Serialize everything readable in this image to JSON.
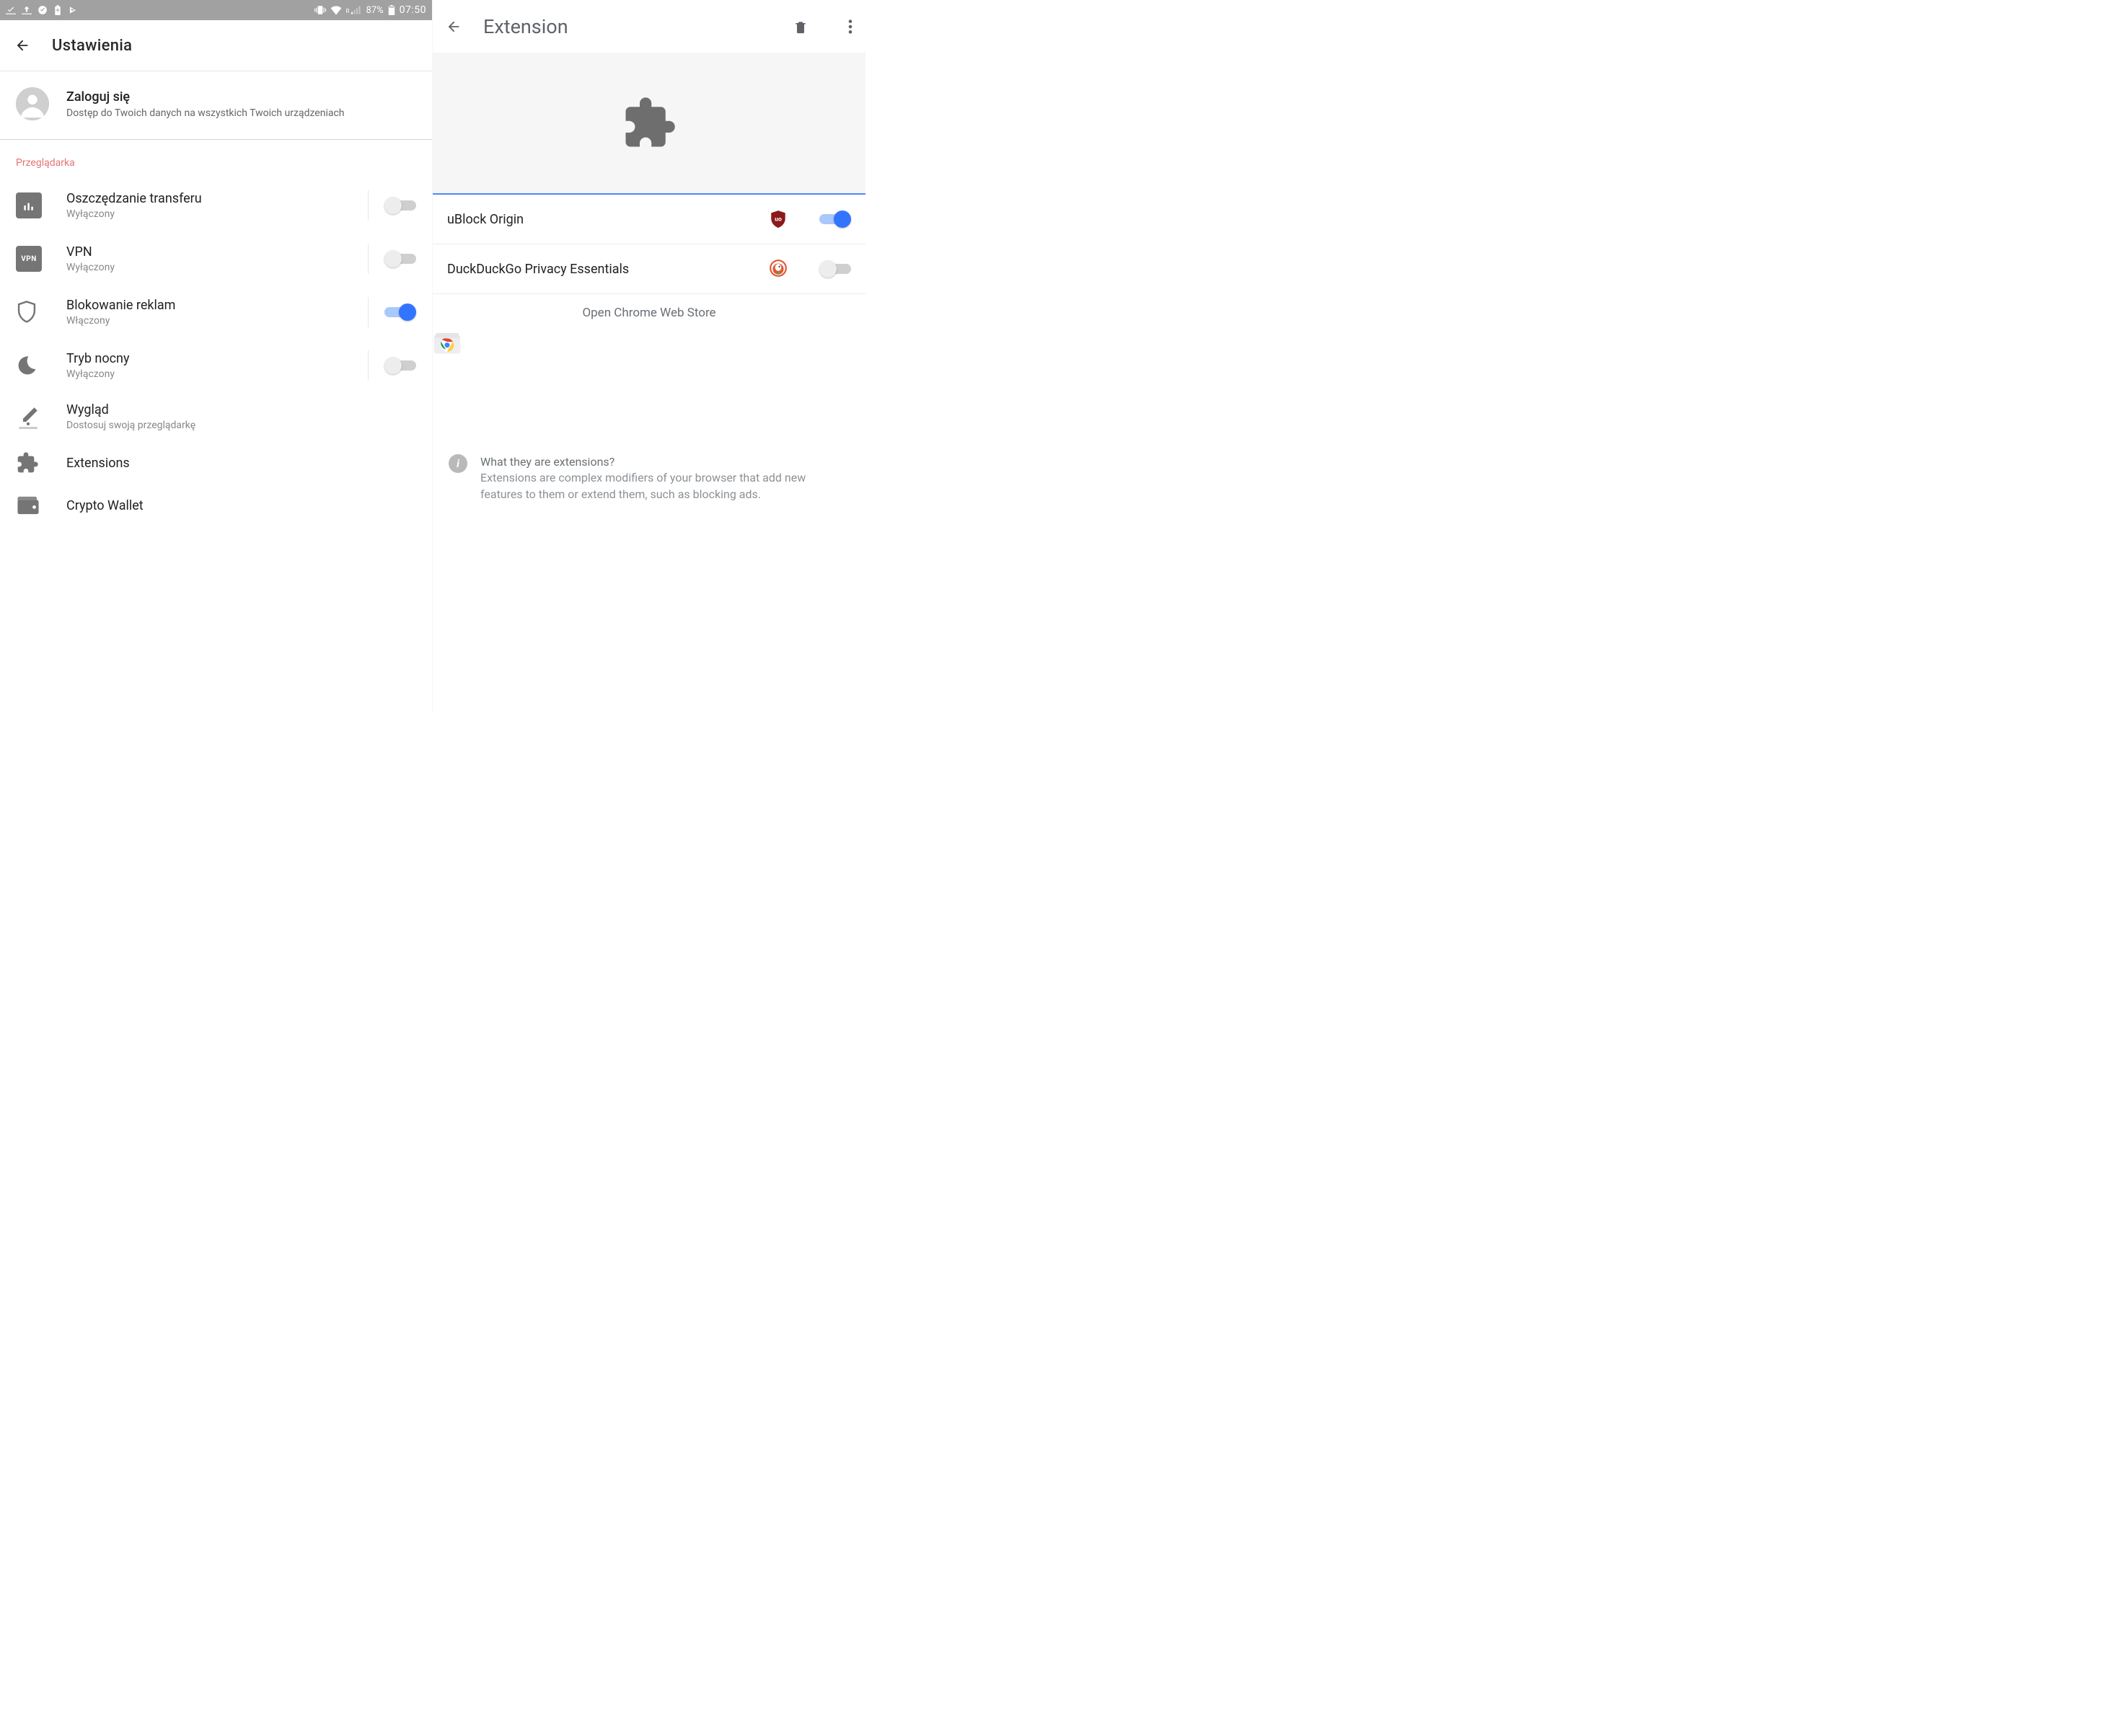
{
  "statusbar": {
    "battery_pct": "87%",
    "time": "07:50",
    "roaming": "R"
  },
  "left": {
    "title": "Ustawienia",
    "login": {
      "title": "Zaloguj się",
      "subtitle": "Dostęp do Twoich danych na wszystkich Twoich urządzeniach"
    },
    "section_label": "Przeglądarka",
    "items": [
      {
        "title": "Oszczędzanie transferu",
        "subtitle": "Wyłączony",
        "icon": "bars-icon",
        "has_toggle": true,
        "toggle_on": false
      },
      {
        "title": "VPN",
        "subtitle": "Wyłączony",
        "icon": "vpn-icon",
        "badge_text": "VPN",
        "has_toggle": true,
        "toggle_on": false
      },
      {
        "title": "Blokowanie reklam",
        "subtitle": "Włączony",
        "icon": "shield-outline-icon",
        "outline": true,
        "has_toggle": true,
        "toggle_on": true
      },
      {
        "title": "Tryb nocny",
        "subtitle": "Wyłączony",
        "icon": "moon-icon",
        "outline": true,
        "has_toggle": true,
        "toggle_on": false
      },
      {
        "title": "Wygląd",
        "subtitle": "Dostosuj swoją przeglądarkę",
        "icon": "paint-icon",
        "outline": true,
        "has_toggle": false
      },
      {
        "title": "Extensions",
        "subtitle": "",
        "icon": "puzzle-small-icon",
        "outline": true,
        "has_toggle": false
      },
      {
        "title": "Crypto Wallet",
        "subtitle": "",
        "icon": "wallet-icon",
        "outline": true,
        "has_toggle": false
      }
    ]
  },
  "right": {
    "title": "Extension",
    "extensions": [
      {
        "name": "uBlock Origin",
        "icon": "ublock-icon",
        "toggle_on": true
      },
      {
        "name": "DuckDuckGo Privacy Essentials",
        "icon": "duckduckgo-icon",
        "toggle_on": false
      }
    ],
    "webstore_label": "Open Chrome Web Store",
    "info": {
      "q": "What they are extensions?",
      "body": "Extensions are complex modifiers of your browser that add new features to them or extend them, such as blocking ads."
    }
  }
}
